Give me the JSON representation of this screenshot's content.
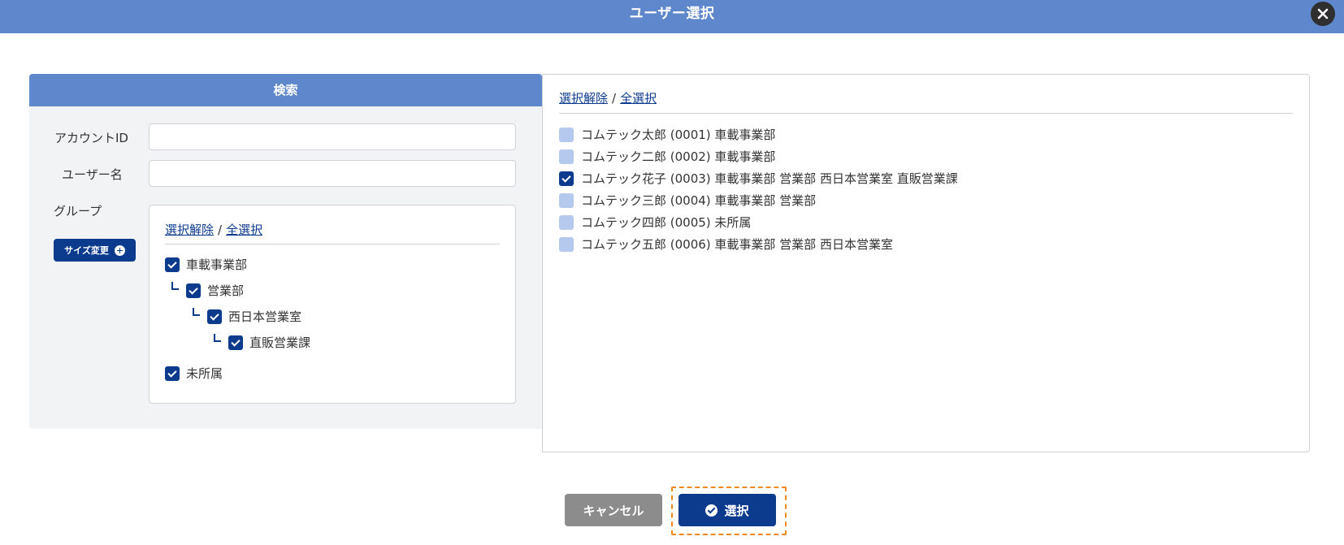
{
  "dialog": {
    "title": "ユーザー選択"
  },
  "search": {
    "header": "検索",
    "account_id_label": "アカウントID",
    "account_id_value": "",
    "user_name_label": "ユーザー名",
    "user_name_value": "",
    "group_label": "グループ",
    "resize_button": "サイズ変更",
    "deselect_all": "選択解除",
    "separator": "/",
    "select_all": "全選択",
    "groups": [
      {
        "label": "車載事業部",
        "checked": true
      },
      {
        "label": "営業部",
        "checked": true
      },
      {
        "label": "西日本営業室",
        "checked": true
      },
      {
        "label": "直販営業課",
        "checked": true
      },
      {
        "label": "未所属",
        "checked": true
      }
    ]
  },
  "users": {
    "deselect_all": "選択解除",
    "separator": "/",
    "select_all": "全選択",
    "items": [
      {
        "label": "コムテック太郎 (0001) 車載事業部",
        "checked": false
      },
      {
        "label": "コムテック二郎 (0002) 車載事業部",
        "checked": false
      },
      {
        "label": "コムテック花子 (0003) 車載事業部 営業部 西日本営業室 直販営業課",
        "checked": true
      },
      {
        "label": "コムテック三郎 (0004) 車載事業部 営業部",
        "checked": false
      },
      {
        "label": "コムテック四郎 (0005) 未所属",
        "checked": false
      },
      {
        "label": "コムテック五郎 (0006) 車載事業部 営業部 西日本営業室",
        "checked": false
      }
    ]
  },
  "footer": {
    "cancel": "キャンセル",
    "select": "選択"
  },
  "colors": {
    "header": "#5f87cc",
    "primary": "#0c3b8e",
    "focus": "#f08a1c",
    "unchecked": "#b5c8ee"
  },
  "icons": {
    "close": "close-icon",
    "resize": "plus-circle-icon",
    "select": "check-circle-icon"
  }
}
